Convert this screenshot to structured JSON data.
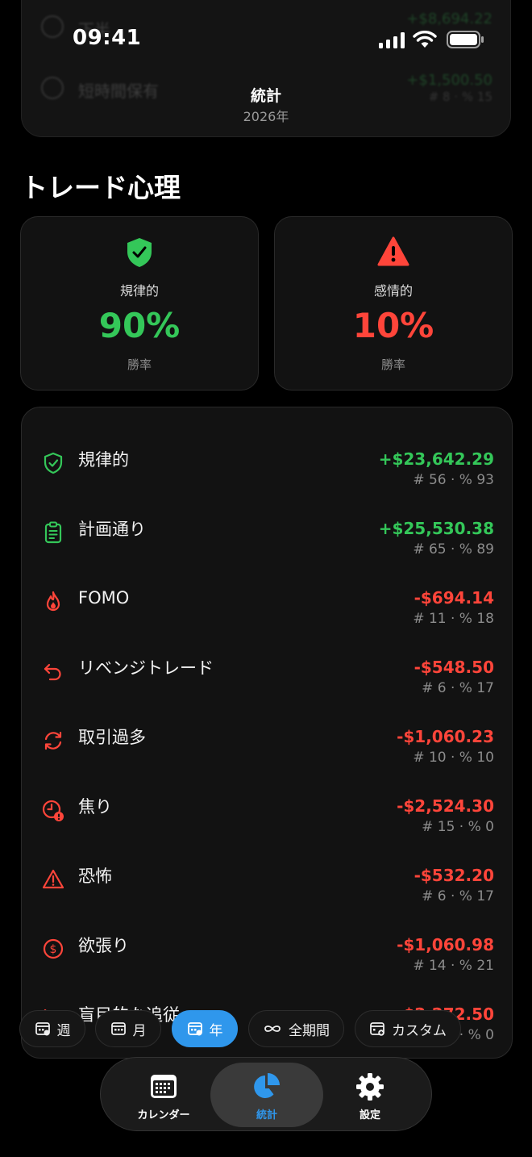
{
  "status": {
    "time": "09:41"
  },
  "header": {
    "title": "統計",
    "subtitle": "2026年"
  },
  "background_rows": [
    {
      "label": "下半",
      "value": "+$8,694.22",
      "meta": ""
    },
    {
      "label": "短時間保有",
      "value": "+$1,500.50",
      "meta": "# 8 · % 15"
    }
  ],
  "section": {
    "title": "トレード心理"
  },
  "summary": {
    "disciplined": {
      "label": "規律的",
      "percent": "90%",
      "sub": "勝率",
      "color": "#34c759"
    },
    "emotional": {
      "label": "感情的",
      "percent": "10%",
      "sub": "勝率",
      "color": "#ff453a"
    }
  },
  "rows": [
    {
      "icon": "shield-check-icon",
      "name": "規律的",
      "amount": "+$23,642.29",
      "meta": "# 56 · % 93",
      "color": "#34c759"
    },
    {
      "icon": "clipboard-icon",
      "name": "計画通り",
      "amount": "+$25,530.38",
      "meta": "# 65 · % 89",
      "color": "#34c759"
    },
    {
      "icon": "flame-icon",
      "name": "FOMO",
      "amount": "-$694.14",
      "meta": "# 11 · % 18",
      "color": "#ff453a"
    },
    {
      "icon": "undo-arrow-icon",
      "name": "リベンジトレード",
      "amount": "-$548.50",
      "meta": "# 6 · % 17",
      "color": "#ff453a"
    },
    {
      "icon": "cycle-arrows-icon",
      "name": "取引過多",
      "amount": "-$1,060.23",
      "meta": "# 10 · % 10",
      "color": "#ff453a"
    },
    {
      "icon": "clock-alert-icon",
      "name": "焦り",
      "amount": "-$2,524.30",
      "meta": "# 15 · % 0",
      "color": "#ff453a"
    },
    {
      "icon": "warning-triangle-icon",
      "name": "恐怖",
      "amount": "-$532.20",
      "meta": "# 6 · % 17",
      "color": "#ff453a"
    },
    {
      "icon": "dollar-circle-icon",
      "name": "欲張り",
      "amount": "-$1,060.98",
      "meta": "# 14 · % 21",
      "color": "#ff453a"
    },
    {
      "icon": "eye-off-icon",
      "name": "盲目的な追従",
      "amount": "-$2,272.50",
      "meta": "# 9 · % 0",
      "color": "#ff453a"
    }
  ],
  "filters": [
    {
      "label": "週",
      "active": false
    },
    {
      "label": "月",
      "active": false
    },
    {
      "label": "年",
      "active": true
    },
    {
      "label": "全期間",
      "active": false
    },
    {
      "label": "カスタム",
      "active": false
    }
  ],
  "tabs": [
    {
      "label": "カレンダー",
      "icon": "calendar-icon",
      "active": false
    },
    {
      "label": "統計",
      "icon": "pie-chart-icon",
      "active": true
    },
    {
      "label": "設定",
      "icon": "gear-icon",
      "active": false
    }
  ],
  "colors": {
    "accent": "#2f97ec",
    "positive": "#34c759",
    "negative": "#ff453a"
  }
}
